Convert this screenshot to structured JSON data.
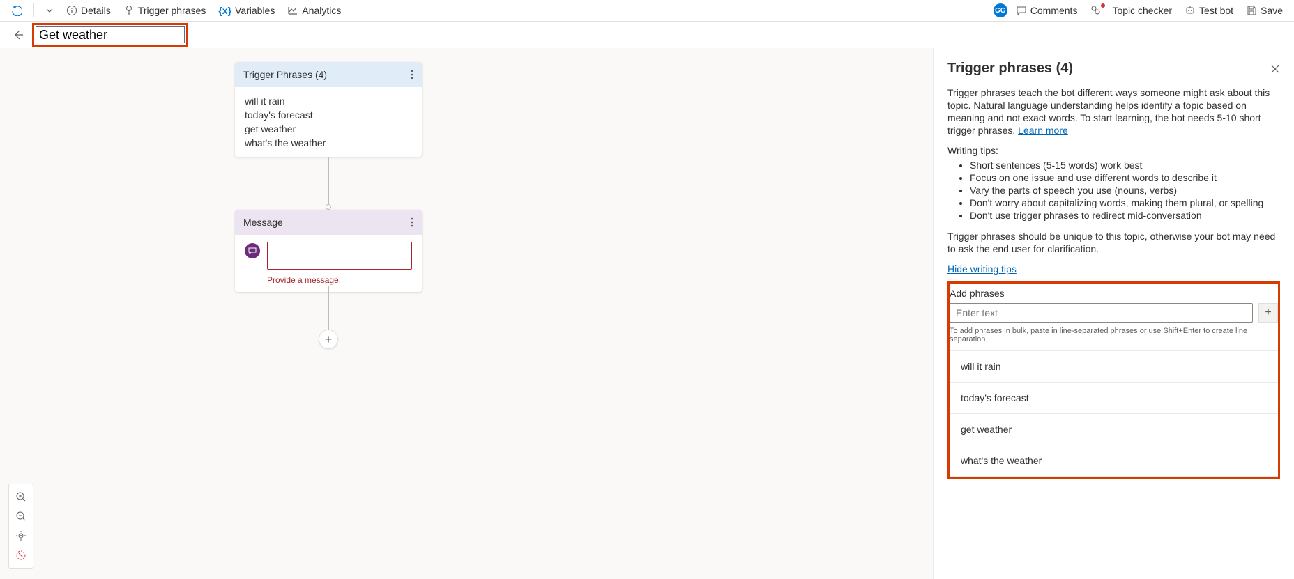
{
  "toolbar": {
    "details": "Details",
    "trigger": "Trigger phrases",
    "variables": "Variables",
    "analytics": "Analytics",
    "avatar": "GG",
    "comments": "Comments",
    "topic_checker": "Topic checker",
    "test_bot": "Test bot",
    "save": "Save"
  },
  "topic_name": "Get weather",
  "trigger_node": {
    "title": "Trigger Phrases (4)",
    "phrases": [
      "will it rain",
      "today's forecast",
      "get weather",
      "what's the weather"
    ]
  },
  "message_node": {
    "title": "Message",
    "error": "Provide a message."
  },
  "panel": {
    "title": "Trigger phrases (4)",
    "intro1": "Trigger phrases teach the bot different ways someone might ask about this topic. Natural language understanding helps identify a topic based on meaning and not exact words. To start learning, the bot needs 5-10 short trigger phrases. ",
    "learn_more": "Learn more",
    "tips_title": "Writing tips:",
    "tips": [
      "Short sentences (5-15 words) work best",
      "Focus on one issue and use different words to describe it",
      "Vary the parts of speech you use (nouns, verbs)",
      "Don't worry about capitalizing words, making them plural, or spelling",
      "Don't use trigger phrases to redirect mid-conversation"
    ],
    "intro2": "Trigger phrases should be unique to this topic, otherwise your bot may need to ask the end user for clarification.",
    "hide_tips": "Hide writing tips",
    "add_label": "Add phrases",
    "placeholder": "Enter text",
    "bulk_hint": "To add phrases in bulk, paste in line-separated phrases or use Shift+Enter to create line separation",
    "phrases": [
      "will it rain",
      "today's forecast",
      "get weather",
      "what's the weather"
    ]
  }
}
